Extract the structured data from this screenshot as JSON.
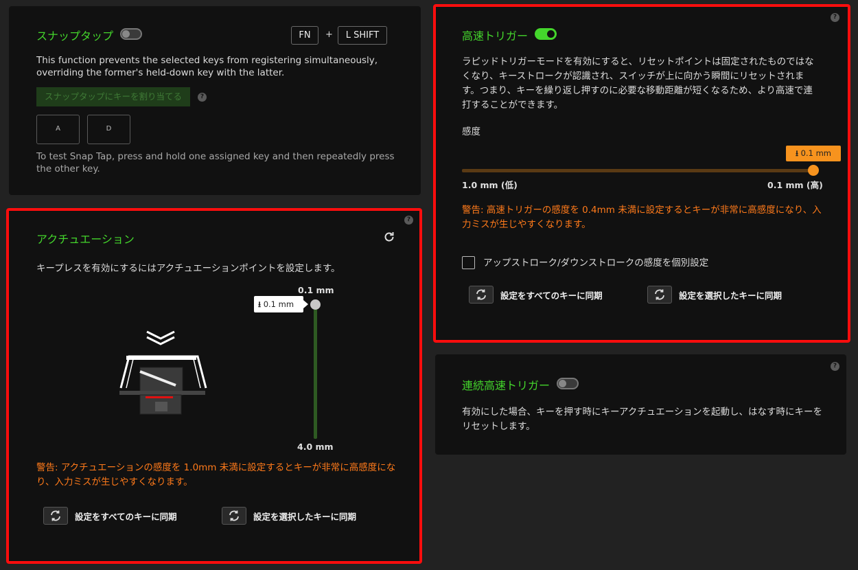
{
  "snap_tap": {
    "title": "スナップタップ",
    "key_fn": "FN",
    "plus": "+",
    "key_shift": "L SHIFT",
    "description": "This function prevents the selected keys from registering simultaneously, overriding the former's held-down key with the latter.",
    "assign_button": "スナップタップにキーを割り当てる",
    "key_a": "A",
    "key_d": "D",
    "test_hint": "To test Snap Tap, press and hold one assigned key and then repeatedly press the other key.",
    "enabled": false
  },
  "actuation": {
    "title": "アクチュエーション",
    "description": "キープレスを有効にするにはアクチュエーションポイントを設定します。",
    "top_label": "0.1 mm",
    "bottom_label": "4.0 mm",
    "tooltip_value": "0.1 mm",
    "value_mm": 0.1,
    "warning": "警告: アクチュエーションの感度を 1.0mm 未満に設定するとキーが非常に高感度になり、入力ミスが生じやすくなります。",
    "sync_all": "設定をすべてのキーに同期",
    "sync_selected": "設定を選択したキーに同期"
  },
  "rapid_trigger": {
    "title": "高速トリガー",
    "enabled": true,
    "description": "ラピッドトリガーモードを有効にすると、リセットポイントは固定されたものではなくなり、キーストロークが認識され、スイッチが上に向かう瞬間にリセットされます。つまり、キーを繰り返し押すのに必要な移動距離が短くなるため、より高速で連打することができます。",
    "sensitivity_label": "感度",
    "tooltip_value": "0.1 mm",
    "value_mm": 0.1,
    "min_label": "1.0 mm (低)",
    "max_label": "0.1 mm (高)",
    "warning": "警告: 高速トリガーの感度を 0.4mm 未満に設定するとキーが非常に高感度になり、入力ミスが生じやすくなります。",
    "checkbox_label": "アップストローク/ダウンストロークの感度を個別設定",
    "sync_all": "設定をすべてのキーに同期",
    "sync_selected": "設定を選択したキーに同期"
  },
  "continuous_rapid_trigger": {
    "title": "連続高速トリガー",
    "enabled": false,
    "description": "有効にした場合、キーを押す時にキーアクチュエーションを起動し、はなす時にキーをリセットします。"
  },
  "help_glyph": "?",
  "colors": {
    "accent_green": "#44d62c",
    "warning_orange": "#ff7a1a",
    "slider_orange": "#f7931e",
    "highlight_red": "#ff0d0d"
  }
}
